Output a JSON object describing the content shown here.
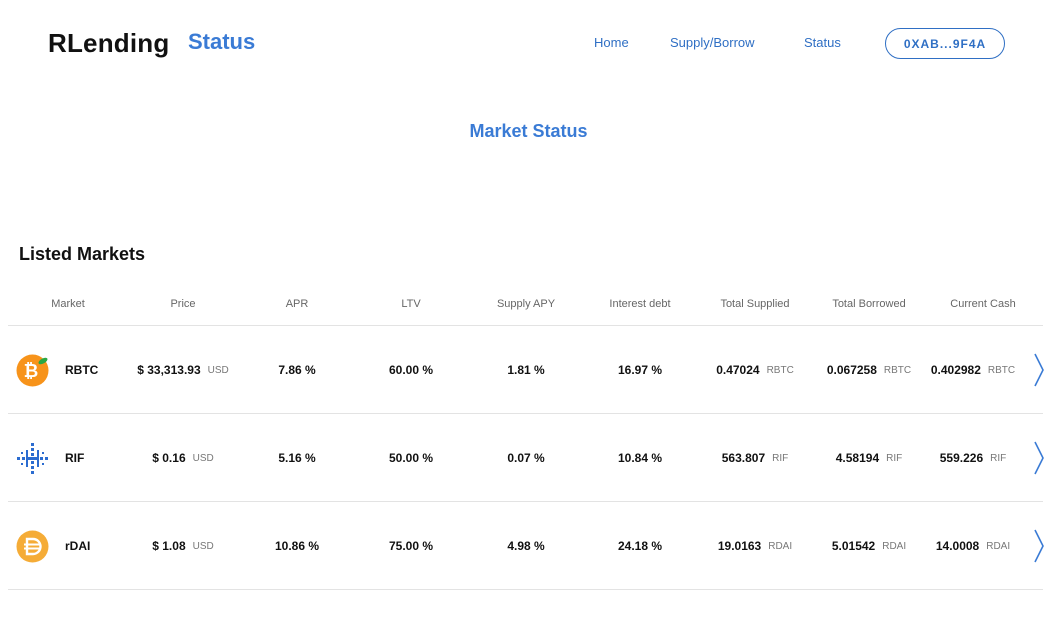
{
  "header": {
    "brand": "RLending",
    "page_subtitle": "Status",
    "nav": [
      "Home",
      "Supply/Borrow",
      "Status"
    ],
    "wallet_address": "0XAB...9F4A"
  },
  "main": {
    "title": "Market Status",
    "section_title": "Listed Markets",
    "columns": [
      "Market",
      "Price",
      "APR",
      "LTV",
      "Supply APY",
      "Interest debt",
      "Total Supplied",
      "Total Borrowed",
      "Current Cash"
    ],
    "rows": [
      {
        "market": "RBTC",
        "icon": "bitcoin-icon",
        "price": "$ 33,313.93",
        "price_unit": "USD",
        "apr": "7.86 %",
        "ltv": "60.00 %",
        "supply_apy": "1.81 %",
        "interest_debt": "16.97 %",
        "total_supplied": "0.47024",
        "total_borrowed": "0.067258",
        "current_cash": "0.402982",
        "token_unit": "RBTC"
      },
      {
        "market": "RIF",
        "icon": "rif-icon",
        "price": "$ 0.16",
        "price_unit": "USD",
        "apr": "5.16 %",
        "ltv": "50.00 %",
        "supply_apy": "0.07 %",
        "interest_debt": "10.84 %",
        "total_supplied": "563.807",
        "total_borrowed": "4.58194",
        "current_cash": "559.226",
        "token_unit": "RIF"
      },
      {
        "market": "rDAI",
        "icon": "dai-icon",
        "price": "$ 1.08",
        "price_unit": "USD",
        "apr": "10.86 %",
        "ltv": "75.00 %",
        "supply_apy": "4.98 %",
        "interest_debt": "24.18 %",
        "total_supplied": "19.0163",
        "total_borrowed": "5.01542",
        "current_cash": "14.0008",
        "token_unit": "RDAI"
      }
    ]
  },
  "colors": {
    "accent": "#3a7bd5",
    "bitcoin": "#f7931a",
    "rif": "#2b6cd0",
    "dai": "#f5ac37"
  }
}
